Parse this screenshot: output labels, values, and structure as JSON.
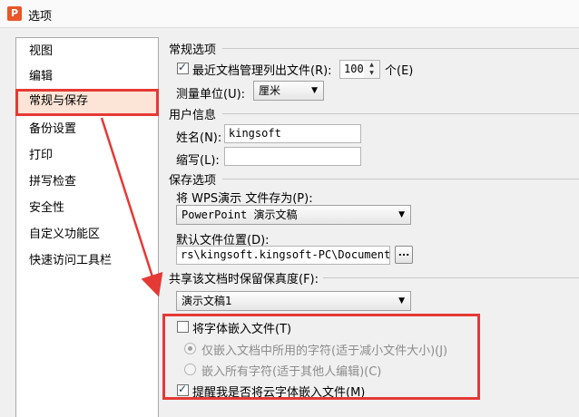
{
  "window": {
    "title": "选项",
    "app_icon_glyph": "P"
  },
  "sidebar": {
    "items": [
      {
        "label": "视图"
      },
      {
        "label": "编辑"
      },
      {
        "label": "常规与保存"
      },
      {
        "label": "备份设置"
      },
      {
        "label": "打印"
      },
      {
        "label": "拼写检查"
      },
      {
        "label": "安全性"
      },
      {
        "label": "自定义功能区"
      },
      {
        "label": "快速访问工具栏"
      }
    ],
    "selected": "常规与保存"
  },
  "general": {
    "title": "常规选项",
    "recent_docs_label": "最近文档管理列出文件(R):",
    "recent_docs_checked": true,
    "recent_docs_count": "100",
    "recent_docs_unit": "个(E)",
    "measure_label": "测量单位(U):",
    "measure_value": "厘米"
  },
  "user_info": {
    "title": "用户信息",
    "name_label": "姓名(N):",
    "name_value": "kingsoft",
    "initials_label": "缩写(L):",
    "initials_value": ""
  },
  "save": {
    "title": "保存选项",
    "save_as_label": "将 WPS演示 文件存为(P):",
    "save_as_value": "PowerPoint 演示文稿",
    "default_location_label": "默认文件位置(D):",
    "default_location_value": "rs\\kingsoft.kingsoft-PC\\Documents",
    "browse_label": "..."
  },
  "fidelity": {
    "title": "共享该文档时保留保真度(F):",
    "document_value": "演示文稿1",
    "embed_fonts_label": "将字体嵌入文件(T)",
    "embed_fonts_checked": false,
    "embed_used_label": "仅嵌入文档中所用的字符(适于减小文件大小)(J)",
    "embed_used_checked": true,
    "embed_all_label": "嵌入所有字符(适于其他人编辑)(C)",
    "embed_all_checked": false,
    "remind_cloud_label": "提醒我是否将云字体嵌入文件(M)",
    "remind_cloud_checked": true
  },
  "colors": {
    "highlight": "#e53935",
    "selected_bg": "#fce4d6",
    "app_icon": "#e8562a"
  }
}
